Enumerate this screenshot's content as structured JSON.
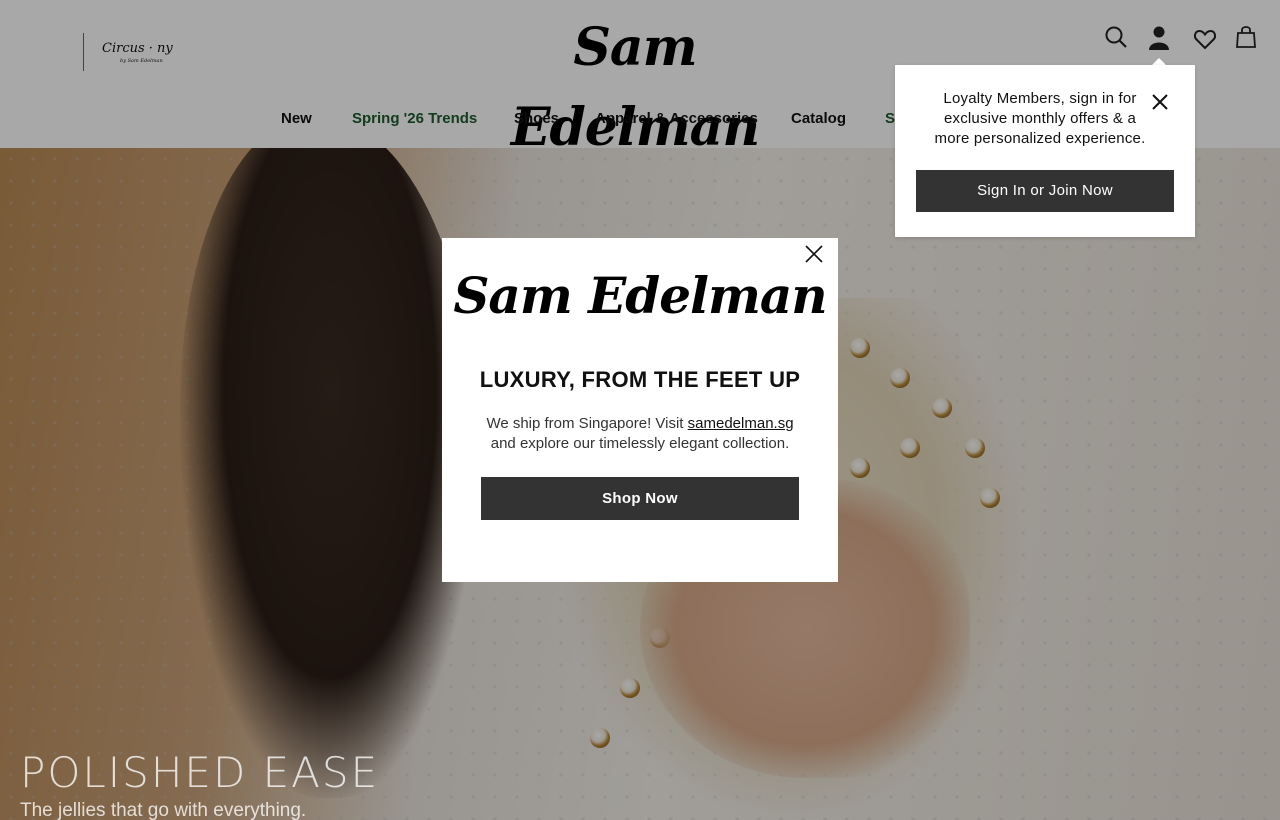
{
  "header": {
    "secondary_brand": "Circus · ny",
    "secondary_brand_sub": "by Sam Edelman",
    "brand": "Sam Edelman",
    "icons": [
      "search-icon",
      "account-icon",
      "heart-icon",
      "bag-icon"
    ]
  },
  "nav": {
    "items": [
      {
        "label": "New"
      },
      {
        "label": "Spring '26 Trends"
      },
      {
        "label": "Shoes"
      },
      {
        "label": "Apparel & Accessories"
      },
      {
        "label": "Catalog"
      },
      {
        "label": "Sa"
      }
    ],
    "accent_color": "#1d5a2d"
  },
  "hero": {
    "title": "POLISHED EASE",
    "subtitle": "The jellies that go with everything."
  },
  "loyalty_popover": {
    "text": "Loyalty Members, sign in for exclusive monthly offers & a more personalized experience.",
    "button": "Sign In or Join Now"
  },
  "modal": {
    "logo": "Sam Edelman",
    "heading": "LUXURY, FROM THE FEET UP",
    "body_before": "We ship from Singapore! Visit",
    "link": "samedelman.sg",
    "body_after": "and explore our timelessly elegant collection.",
    "button": "Shop Now"
  },
  "colors": {
    "button_bg": "#333333",
    "overlay": "rgba(0,0,0,0.34)"
  }
}
